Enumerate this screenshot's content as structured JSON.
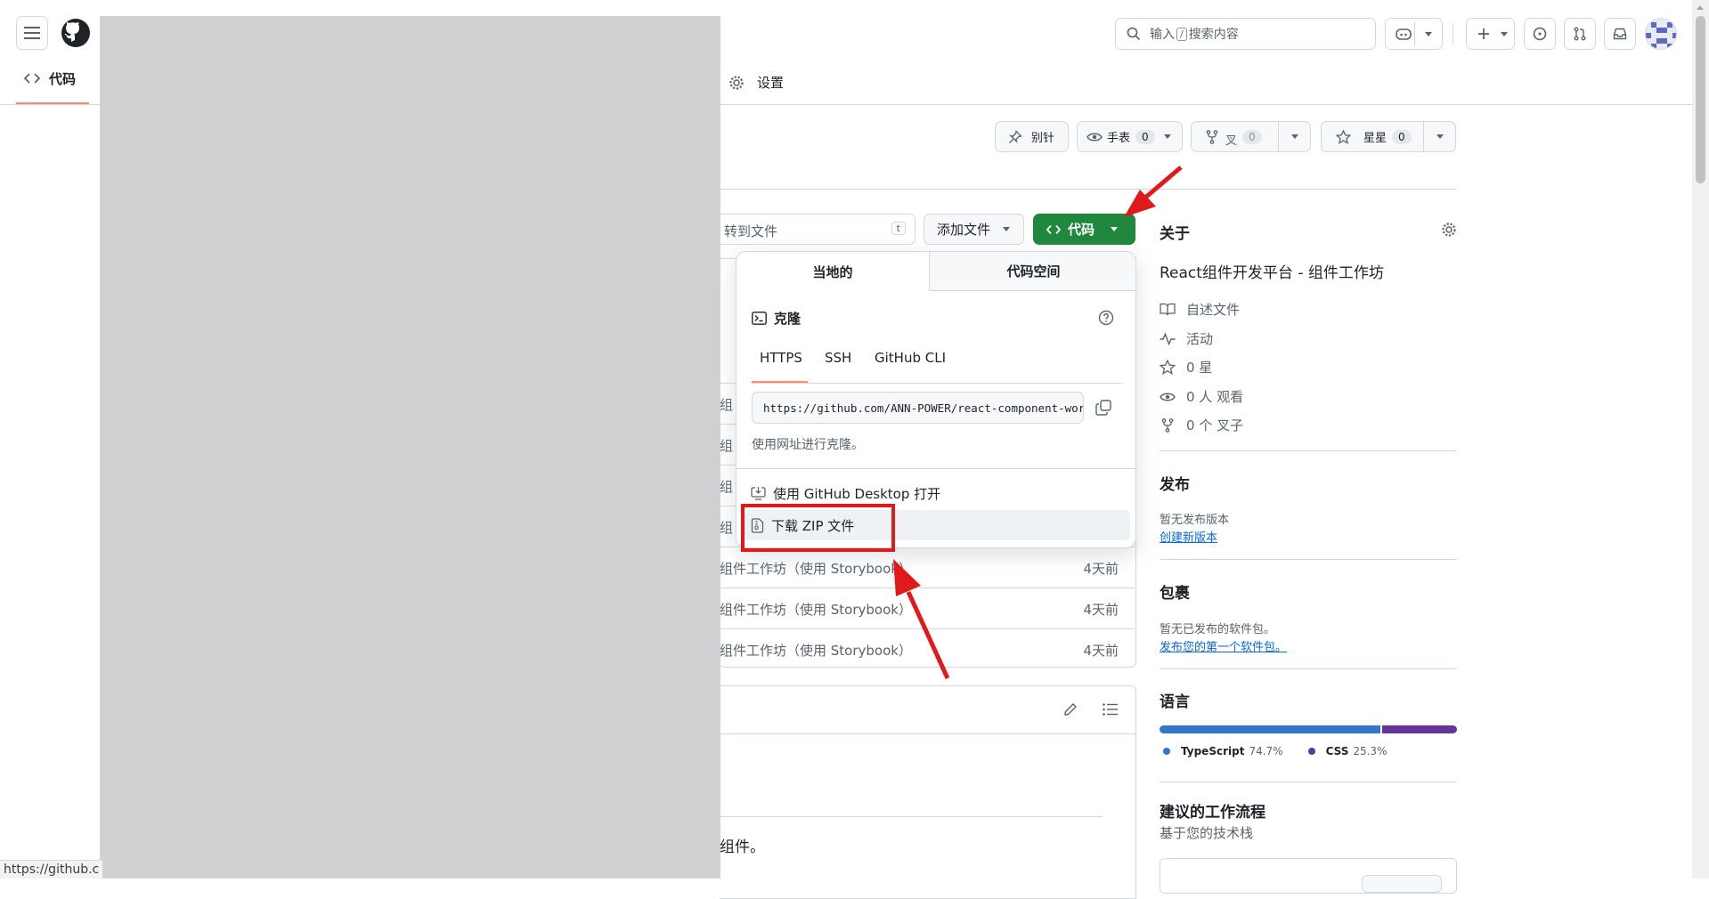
{
  "header": {
    "search_placeholder": "输入 / 搜索内容",
    "search_prefix": "输入",
    "search_key": "/",
    "search_suffix": "搜索内容"
  },
  "repo_nav": {
    "code_tab": "代码",
    "settings_tab": "设置"
  },
  "repo_actions": {
    "pin": "别针",
    "watch": "手表",
    "watch_count": "0",
    "fork": "叉",
    "fork_count": "0",
    "star": "星星",
    "star_count": "0"
  },
  "file_bar": {
    "goto_file": "转到文件",
    "goto_key": "t",
    "add_file": "添加文件",
    "code_button": "代码"
  },
  "code_dropdown": {
    "tab_local": "当地的",
    "tab_codespaces": "代码空间",
    "clone_title": "克隆",
    "clone_tabs": [
      "HTTPS",
      "SSH",
      "GitHub CLI"
    ],
    "clone_url": "https://github.com/ANN-POWER/react-component-workshop",
    "clone_hint": "使用网址进行克隆。",
    "open_desktop": "使用 GitHub Desktop 打开",
    "download_zip": "下载 ZIP 文件"
  },
  "file_rows": [
    {
      "msg": "组",
      "age": ""
    },
    {
      "msg": "组",
      "age": ""
    },
    {
      "msg": "组",
      "age": ""
    },
    {
      "msg": "组",
      "age": ""
    },
    {
      "msg": "组件工作坊（使用 Storybook）",
      "age": "4天前"
    },
    {
      "msg": "组件工作坊（使用 Storybook）",
      "age": "4天前"
    },
    {
      "msg": "组件工作坊（使用 Storybook）",
      "age": "4天前"
    }
  ],
  "readme": {
    "partial_text": "组件。"
  },
  "about": {
    "title": "关于",
    "description": "React组件开发平台 - 组件工作坊",
    "readme": "自述文件",
    "activity": "活动",
    "stars": "0 星",
    "watchers": "0 人 观看",
    "forks": "0 个 叉子"
  },
  "releases": {
    "title": "发布",
    "empty": "暂无发布版本",
    "create": "创建新版本"
  },
  "packages": {
    "title": "包裹",
    "empty": "暂无已发布的软件包。",
    "publish": "发布您的第一个软件包。"
  },
  "languages": {
    "title": "语言",
    "items": [
      {
        "name": "TypeScript",
        "percent": "74.7%",
        "value": 74.7,
        "color": "#3178c6"
      },
      {
        "name": "CSS",
        "percent": "25.3%",
        "value": 25.3,
        "color": "#663399"
      }
    ]
  },
  "workflows": {
    "title": "建议的工作流程",
    "subtitle": "基于您的技术栈"
  },
  "status_bar": {
    "url": "https://github.c"
  },
  "colors": {
    "primary_green": "#1f883d",
    "annotation_red": "#e0191a",
    "redaction_gray": "#cfd0d2"
  }
}
